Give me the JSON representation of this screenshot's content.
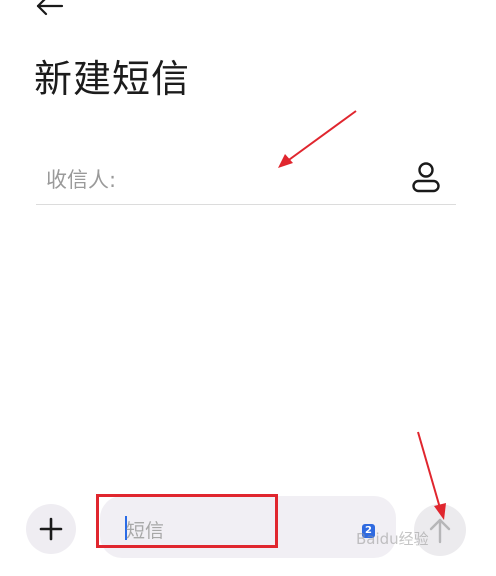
{
  "header": {
    "title": "新建短信"
  },
  "recipient": {
    "label": "收信人:"
  },
  "composer": {
    "placeholder": "短信",
    "sim_badge": "2"
  },
  "icons": {
    "back": "arrow-left-icon",
    "contact": "contact-person-icon",
    "add": "plus-icon",
    "send": "arrow-up-icon"
  },
  "watermark": {
    "text": "Baidu经验"
  },
  "colors": {
    "annotation": "#e0262e",
    "accent": "#2f6ae0"
  }
}
